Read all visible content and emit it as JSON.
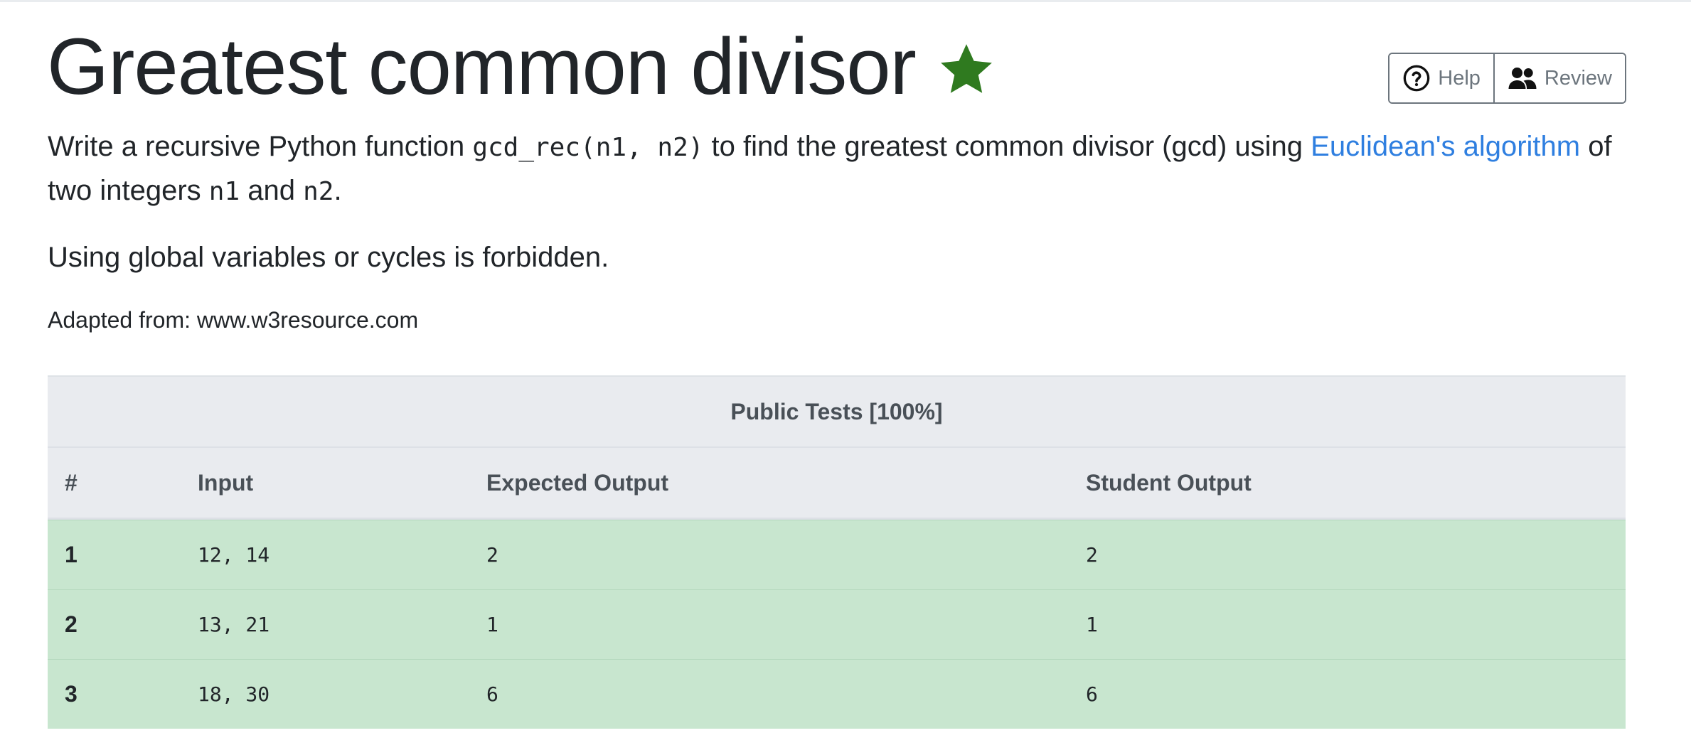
{
  "title": "Greatest common divisor",
  "star_color": "#2f7a1f",
  "buttons": {
    "help": {
      "label": "Help",
      "icon": "question-circle-icon"
    },
    "review": {
      "label": "Review",
      "icon": "people-icon"
    }
  },
  "description": {
    "p1_part1": "Write a recursive Python function ",
    "p1_code1": "gcd_rec(n1, n2)",
    "p1_part2": " to find the greatest common divisor (gcd) using ",
    "p1_link": "Euclidean's algorithm",
    "p1_part3": " of two integers ",
    "p1_code2": "n1",
    "p1_part4": " and ",
    "p1_code3": "n2",
    "p1_part5": ".",
    "p2": "Using global variables or cycles is forbidden."
  },
  "adapted_from": "Adapted from: www.w3resource.com",
  "tests": {
    "caption": "Public Tests [100%]",
    "headers": {
      "num": "#",
      "input": "Input",
      "expected": "Expected Output",
      "student": "Student Output"
    },
    "rows": [
      {
        "num": "1",
        "input": "12, 14",
        "expected": "2",
        "student": "2"
      },
      {
        "num": "2",
        "input": "13, 21",
        "expected": "1",
        "student": "1"
      },
      {
        "num": "3",
        "input": "18, 30",
        "expected": "6",
        "student": "6"
      }
    ],
    "pass_color": "#c8e6cf"
  }
}
